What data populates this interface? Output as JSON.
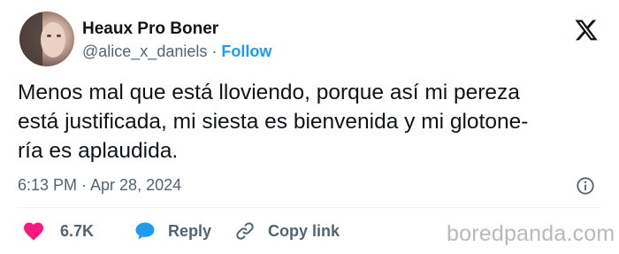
{
  "author": {
    "display_name": "Heaux Pro Boner",
    "handle": "@alice_x_daniels",
    "separator": "·",
    "follow_label": "Follow"
  },
  "tweet": {
    "lines": [
      "Menos mal que está lloviendo, porque así mi pereza",
      "está justificada, mi siesta es bienvenida y mi glotone-",
      "ría es aplaudida."
    ],
    "timestamp": "6:13 PM · Apr 28, 2024"
  },
  "actions": {
    "like_count": "6.7K",
    "reply_label": "Reply",
    "copy_link_label": "Copy link"
  },
  "icons": {
    "platform": "x-logo-icon",
    "info": "info-icon",
    "like": "heart-icon",
    "reply": "speech-bubble-icon",
    "copy": "link-icon"
  },
  "colors": {
    "accent": "#1d9bf0",
    "like": "#f91880",
    "text": "#0f1419",
    "muted": "#536471",
    "watermark": "#b9b9b9"
  },
  "watermark": "boredpanda.com"
}
